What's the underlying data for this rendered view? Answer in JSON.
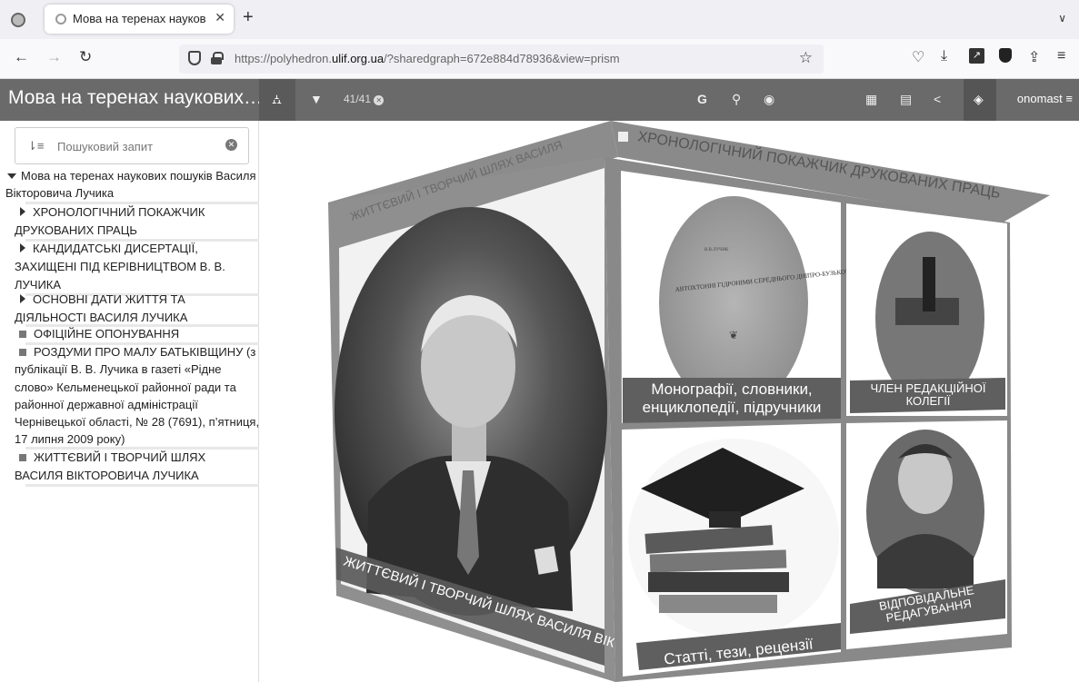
{
  "browser": {
    "tab_title": "Мова на теренах науков",
    "tab_close": "✕",
    "new_tab": "+",
    "tab_list": "∨",
    "url_host_pre": "https://polyhedron.",
    "url_host": "ulif.org.ua",
    "url_path": "/?sharedgraph=672e884d78936&view=prism"
  },
  "toolbar": {
    "title": "Мова на теренах наукових…",
    "filter_count": "41/41",
    "user": "onomast"
  },
  "sidebar": {
    "search_placeholder": "Пошуковий запит",
    "root_label": "Мова на теренах наукових пошуків Василя Вікторовича Лучика",
    "items": [
      {
        "type": "branch",
        "label": "ХРОНОЛОГІЧНИЙ ПОКАЖЧИК ДРУКОВАНИХ ПРАЦЬ"
      },
      {
        "type": "branch",
        "label": "КАНДИДАТСЬКІ ДИСЕРТАЦІЇ, ЗАХИЩЕНІ ПІД КЕРІВНИЦТВОМ В. В. ЛУЧИКА"
      },
      {
        "type": "branch",
        "label": "ОСНОВНІ ДАТИ ЖИТТЯ ТА ДІЯЛЬНОСТІ ВАСИЛЯ ЛУЧИКА"
      },
      {
        "type": "leaf",
        "label": "ОФІЦІЙНЕ ОПОНУВАННЯ"
      },
      {
        "type": "leaf",
        "label": "РОЗДУМИ ПРО МАЛУ БАТЬКІВЩИНУ (з публікації В. В. Лучика в газеті «Рідне слово» Кельменецької районної ради та районної державної адміністрації Чернівецької області, № 28 (7691), п’ятниця, 17 липня 2009 року)"
      },
      {
        "type": "leaf",
        "label": "ЖИТТЄВИЙ І ТВОРЧИЙ ШЛЯХ ВАСИЛЯ ВІКТОРОВИЧА ЛУЧИКА"
      }
    ]
  },
  "prism": {
    "top_face_title": "ХРОНОЛОГІЧНИЙ ПОКАЖЧИК ДРУКОВАНИХ ПРАЦЬ",
    "left_face_top": "ЖИТТЄВИЙ І ТВОРЧИЙ ШЛЯХ ВАСИЛЯ",
    "left_face_caption": "ЖИТТЄВИЙ І ТВОРЧИЙ ШЛЯХ ВАСИЛЯ ВІКТОРОВИЧА ЛУЧИКА",
    "book_title": "АВТОХТОННІ ГІДРОНІМИ СЕРЕДНЬОГО ДНІПРО-БУЗЬКОГО МЕЖИРІЧЧЯ",
    "book_author": "В.В.ЛУЧИК",
    "tiles": [
      {
        "label": "Монографії, словники, енциклопедії, підручники"
      },
      {
        "label": "ЧЛЕН РЕДАКЦІЙНОЇ КОЛЕГІЇ"
      },
      {
        "label": "Статті, тези, рецензії"
      },
      {
        "label": "ВІДПОВІДАЛЬНЕ РЕДАГУВАННЯ"
      }
    ]
  }
}
